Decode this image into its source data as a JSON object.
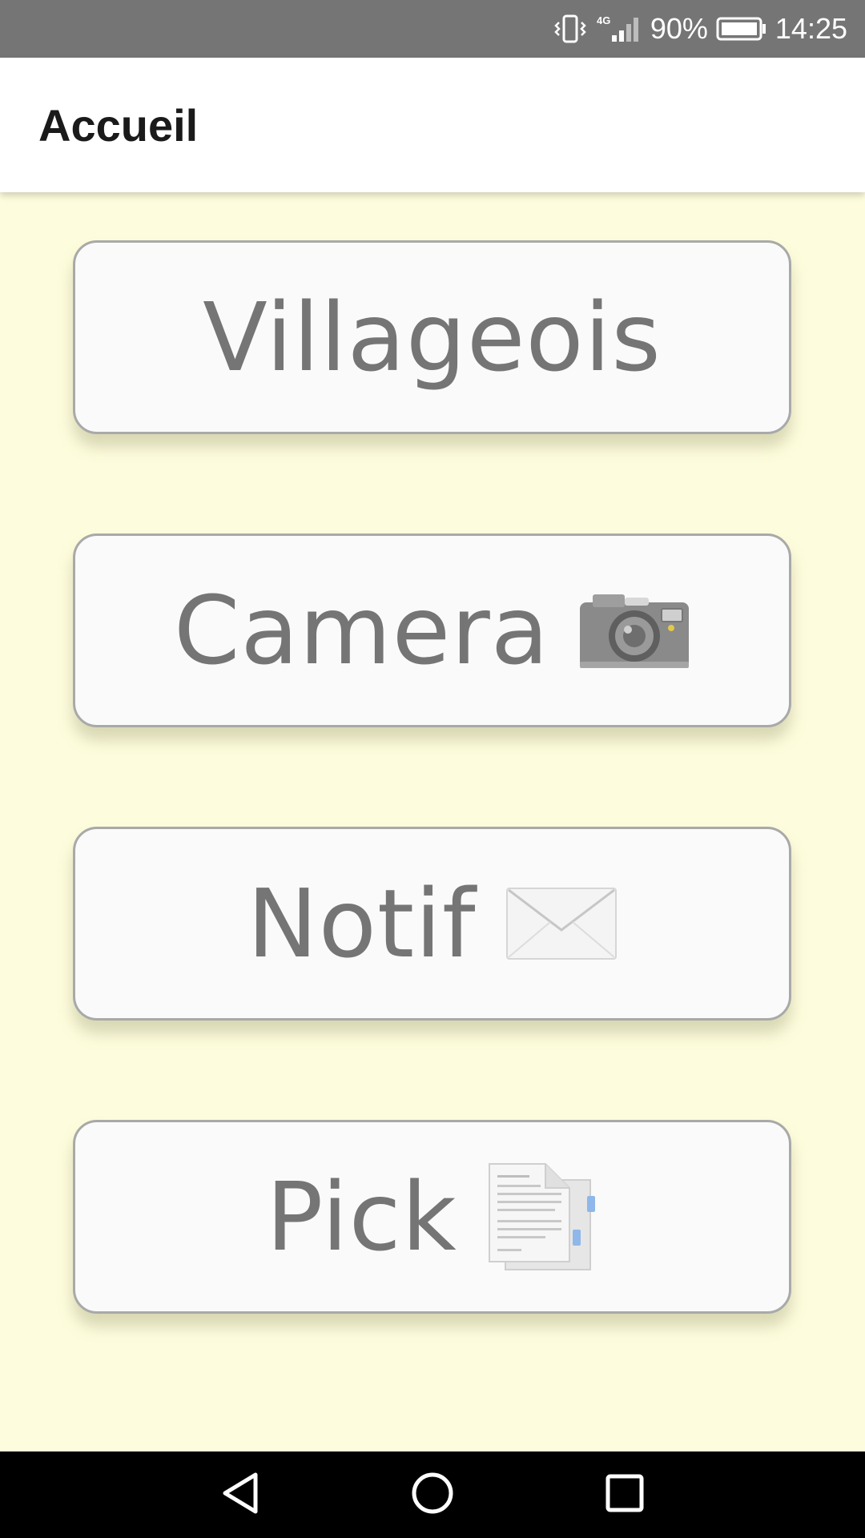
{
  "status_bar": {
    "icons": [
      "vibrate-icon",
      "signal-4g-icon",
      "battery-icon"
    ],
    "network": "4G",
    "battery": "90%",
    "time": "14:25"
  },
  "app_bar": {
    "title": "Accueil"
  },
  "menu": {
    "buttons": [
      {
        "label": "Villageois",
        "icon": ""
      },
      {
        "label": "Camera",
        "icon": "camera-icon"
      },
      {
        "label": "Notif",
        "icon": "envelope-icon"
      },
      {
        "label": "Pick",
        "icon": "document-icon"
      }
    ]
  },
  "nav_bar": {
    "icons": [
      "back-icon",
      "home-icon",
      "recents-icon"
    ]
  },
  "colors": {
    "background": "#fdfcdc",
    "status_bar": "#757575",
    "button_text": "#757575",
    "button_border": "#a9a9a9"
  }
}
